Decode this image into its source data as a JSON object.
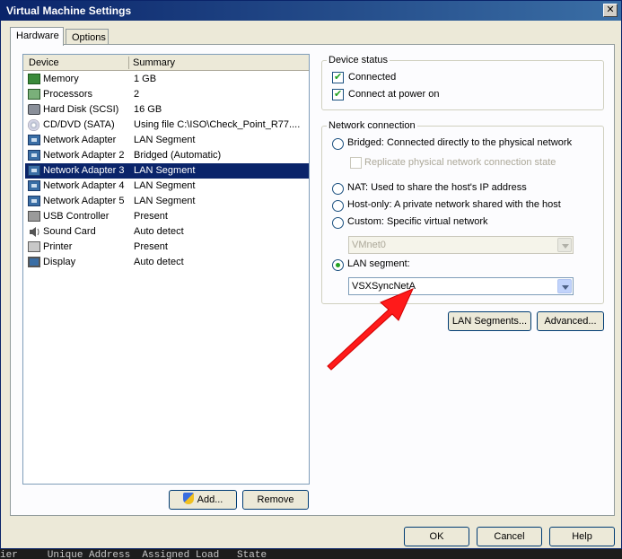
{
  "window": {
    "title": "Virtual Machine Settings",
    "close_label": "✕"
  },
  "tabs": [
    {
      "label": "Hardware"
    },
    {
      "label": "Options"
    }
  ],
  "devices": {
    "col_device": "Device",
    "col_summary": "Summary",
    "items": [
      {
        "name": "Memory",
        "summary": "1 GB",
        "icon": "memory-icon"
      },
      {
        "name": "Processors",
        "summary": "2",
        "icon": "processor-icon"
      },
      {
        "name": "Hard Disk (SCSI)",
        "summary": "16 GB",
        "icon": "hard-disk-icon"
      },
      {
        "name": "CD/DVD (SATA)",
        "summary": "Using file C:\\ISO\\Check_Point_R77....",
        "icon": "cd-dvd-icon"
      },
      {
        "name": "Network Adapter",
        "summary": "LAN Segment",
        "icon": "network-adapter-icon"
      },
      {
        "name": "Network Adapter 2",
        "summary": "Bridged (Automatic)",
        "icon": "network-adapter-icon"
      },
      {
        "name": "Network Adapter 3",
        "summary": "LAN Segment",
        "icon": "network-adapter-icon",
        "selected": true
      },
      {
        "name": "Network Adapter 4",
        "summary": "LAN Segment",
        "icon": "network-adapter-icon"
      },
      {
        "name": "Network Adapter 5",
        "summary": "LAN Segment",
        "icon": "network-adapter-icon"
      },
      {
        "name": "USB Controller",
        "summary": "Present",
        "icon": "usb-icon"
      },
      {
        "name": "Sound Card",
        "summary": "Auto detect",
        "icon": "sound-icon"
      },
      {
        "name": "Printer",
        "summary": "Present",
        "icon": "printer-icon"
      },
      {
        "name": "Display",
        "summary": "Auto detect",
        "icon": "display-icon"
      }
    ],
    "add_label": "Add...",
    "remove_label": "Remove"
  },
  "device_status": {
    "title": "Device status",
    "connected": {
      "label": "Connected",
      "checked": true
    },
    "connect_at_power_on": {
      "label": "Connect at power on",
      "checked": true
    }
  },
  "network_connection": {
    "title": "Network connection",
    "bridged": {
      "label": "Bridged: Connected directly to the physical network",
      "selected": false
    },
    "replicate": {
      "label": "Replicate physical network connection state",
      "checked": false,
      "disabled": true
    },
    "nat": {
      "label": "NAT: Used to share the host's IP address",
      "selected": false
    },
    "host_only": {
      "label": "Host-only: A private network shared with the host",
      "selected": false
    },
    "custom": {
      "label": "Custom: Specific virtual network",
      "selected": false
    },
    "custom_value": "VMnet0",
    "lan_segment": {
      "label": "LAN segment:",
      "selected": true
    },
    "lan_segment_value": "VSXSyncNetA",
    "lan_segments_button": "LAN Segments...",
    "advanced_button": "Advanced..."
  },
  "footer": {
    "ok": "OK",
    "cancel": "Cancel",
    "help": "Help"
  },
  "background_text": "ier     Unique Address  Assigned Load   State",
  "colors": {
    "selection": "#0a246a",
    "annotation_arrow": "#ff1a1a"
  }
}
